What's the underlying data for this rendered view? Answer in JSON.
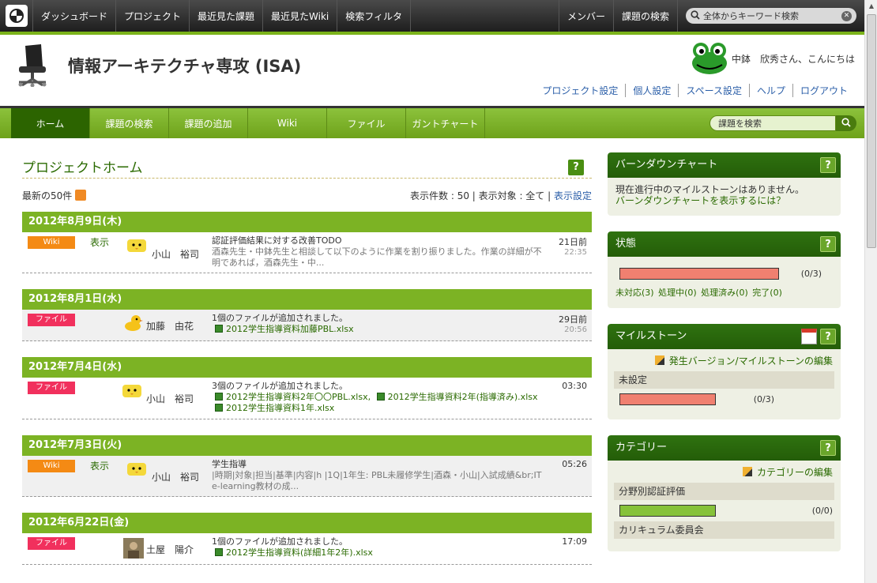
{
  "topbar": {
    "nav": [
      "ダッシュボード",
      "プロジェクト",
      "最近見た課題",
      "最近見たWiki",
      "検索フィルタ"
    ],
    "right_nav": [
      "メンバー",
      "課題の検索"
    ],
    "search_placeholder": "全体からキーワード検索"
  },
  "header": {
    "project_title": "情報アーキテクチャ専攻 (ISA)",
    "greeting": "中鉢　欣秀さん、こんにちは",
    "links": [
      "プロジェクト設定",
      "個人設定",
      "スペース設定",
      "ヘルプ",
      "ログアウト"
    ]
  },
  "project_nav": {
    "tabs": [
      "ホーム",
      "課題の検索",
      "課題の追加",
      "Wiki",
      "ファイル",
      "ガントチャート"
    ],
    "search_placeholder": "課題を検索"
  },
  "main": {
    "title": "プロジェクトホーム",
    "recent_label": "最新の50件",
    "display_info": "表示件数 : 50 | 表示対象 : 全て | ",
    "display_settings": "表示設定",
    "days": [
      {
        "date": "2012年8月9日(木)",
        "entries": [
          {
            "type": "Wiki",
            "view": "表示",
            "user": "小山　裕司",
            "title": "認証評価結果に対する改善TODO",
            "sub": "酒森先生・中鉢先生と相談して以下のように作業を割り振りました。作業の詳細が不明であれば，酒森先生・中...",
            "ago": "21日前",
            "time": "22:35"
          }
        ]
      },
      {
        "date": "2012年8月1日(水)",
        "entries": [
          {
            "type": "ファイル",
            "user": "加藤　由花",
            "title": "1個のファイルが追加されました。",
            "files": [
              "2012学生指導資料加藤PBL.xlsx"
            ],
            "ago": "29日前",
            "time": "20:56"
          }
        ]
      },
      {
        "date": "2012年7月4日(水)",
        "entries": [
          {
            "type": "ファイル",
            "user": "小山　裕司",
            "title": "3個のファイルが追加されました。",
            "files": [
              "2012学生指導資料2年〇〇PBL.xlsx,",
              "2012学生指導資料2年(指導済み).xlsx",
              "2012学生指導資料1年.xlsx"
            ],
            "time": "03:30"
          }
        ]
      },
      {
        "date": "2012年7月3日(火)",
        "entries": [
          {
            "type": "Wiki",
            "view": "表示",
            "user": "小山　裕司",
            "title": "学生指導",
            "sub": "|時期|対象|担当|基準|内容|h |1Q|1年生: PBL未履修学生|酒森・小山|入試成績&br;IT e-learning教材の成...",
            "time": "05:26"
          }
        ]
      },
      {
        "date": "2012年6月22日(金)",
        "entries": [
          {
            "type": "ファイル",
            "user": "土屋　陽介",
            "title": "1個のファイルが追加されました。",
            "files": [
              "2012学生指導資料(詳細1年2年).xlsx"
            ],
            "time": "17:09"
          }
        ]
      }
    ]
  },
  "sidebar": {
    "burndown": {
      "title": "バーンダウンチャート",
      "text": "現在進行中のマイルストーンはありません。",
      "link": "バーンダウンチャートを表示するには？"
    },
    "status": {
      "title": "状態",
      "count": "(0/3)",
      "links": [
        "未対応(3)",
        "処理中(0)",
        "処理済み(0)",
        "完了(0)"
      ]
    },
    "milestone": {
      "title": "マイルストーン",
      "edit": "発生バージョン/マイルストーンの編集",
      "group": "未設定",
      "count": "(0/3)"
    },
    "category": {
      "title": "カテゴリー",
      "edit": "カテゴリーの編集",
      "groups": [
        {
          "name": "分野別認証評価",
          "count": "(0/0)"
        },
        {
          "name": "カリキュラム委員会"
        }
      ]
    }
  },
  "colors": {
    "brand_green": "#7cb324",
    "dark_green": "#2c6400",
    "wiki_badge": "#f48a14",
    "file_badge": "#f1305d"
  },
  "icons": [
    "logo-icon",
    "search-icon",
    "clear-icon",
    "chair-logo-icon",
    "frog-avatar-icon",
    "rss-icon",
    "help-icon",
    "calendar-icon",
    "pencil-icon",
    "excel-file-icon"
  ]
}
